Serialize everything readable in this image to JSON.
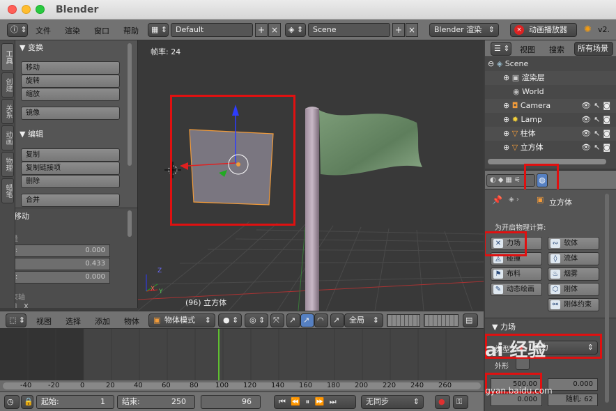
{
  "window": {
    "title": "Blender"
  },
  "infobar": {
    "menus": [
      "文件",
      "渲染",
      "窗口",
      "帮助"
    ],
    "layout": "Default",
    "scene": "Scene",
    "engine": "Blender 渲染",
    "anim_button": "动画播放器",
    "version": "v2."
  },
  "shelf": {
    "tabs": [
      "工具",
      "创建",
      "关系",
      "动画",
      "物理",
      "蜡笔"
    ],
    "transform_title": "变换",
    "transform_buttons": [
      "移动",
      "旋转",
      "缩放",
      "镜像"
    ],
    "edit_title": "编辑",
    "edit_buttons": [
      "复制",
      "复制链接项",
      "删除",
      "合并"
    ],
    "move_title": "移动",
    "vector_label": "矢量",
    "vector": [
      {
        "label": "X:",
        "value": "0.000"
      },
      {
        "label": "Y:",
        "value": "0.433"
      },
      {
        "label": "Z:",
        "value": "0.000"
      }
    ],
    "constraint_label": "约束轴",
    "constraint_x": "X"
  },
  "viewport": {
    "fps_label": "帧率: 24",
    "object_label": "(96) 立方体",
    "axis_x": "X",
    "axis_y": "Y",
    "axis_z": "Z"
  },
  "vp_header": {
    "menus": [
      "视图",
      "选择",
      "添加",
      "物体"
    ],
    "mode": "物体模式",
    "pivot": "全局"
  },
  "timeline": {
    "ticks": [
      "-40",
      "-20",
      "0",
      "20",
      "40",
      "60",
      "80",
      "100",
      "120",
      "140",
      "160",
      "180",
      "200",
      "220",
      "240",
      "260"
    ],
    "current_frame": 96,
    "start_label": "起始:",
    "start": "1",
    "end_label": "结束:",
    "end": "250",
    "frame": "96",
    "sync": "无同步"
  },
  "outliner": {
    "menus": [
      "视图",
      "搜索"
    ],
    "filter": "所有场景",
    "items": [
      {
        "name": "Scene",
        "icon": "scene-icon"
      },
      {
        "name": "渲染层",
        "icon": "render-layers-icon"
      },
      {
        "name": "World",
        "icon": "world-icon"
      },
      {
        "name": "Camera",
        "icon": "camera-icon"
      },
      {
        "name": "Lamp",
        "icon": "lamp-icon"
      },
      {
        "name": "柱体",
        "icon": "mesh-icon"
      },
      {
        "name": "立方体",
        "icon": "mesh-icon"
      }
    ]
  },
  "properties": {
    "context_object": "立方体",
    "enable_label": "为开启物理计算:",
    "buttons": [
      {
        "label": "力场",
        "icon": "x-icon"
      },
      {
        "label": "软体",
        "icon": "softbody-icon"
      },
      {
        "label": "碰撞",
        "icon": "collision-icon"
      },
      {
        "label": "流体",
        "icon": "fluid-icon"
      },
      {
        "label": "布料",
        "icon": "cloth-icon"
      },
      {
        "label": "烟雾",
        "icon": "smoke-icon"
      },
      {
        "label": "动态绘画",
        "icon": "dynamic-paint-icon"
      },
      {
        "label": "刚体",
        "icon": "rigidbody-icon"
      },
      {
        "label": "刚体约束",
        "icon": "rigidbody-constraint-icon"
      }
    ],
    "field_title": "力场",
    "type_label": "类型",
    "type_value": "风力",
    "shape_label": "外形",
    "strength": "500.00",
    "flow": "0.000",
    "noise_value": "0.000",
    "seed": "随机: 62"
  },
  "watermark": {
    "text": "Bai 经验",
    "url": "jingyan.baidu.com"
  }
}
